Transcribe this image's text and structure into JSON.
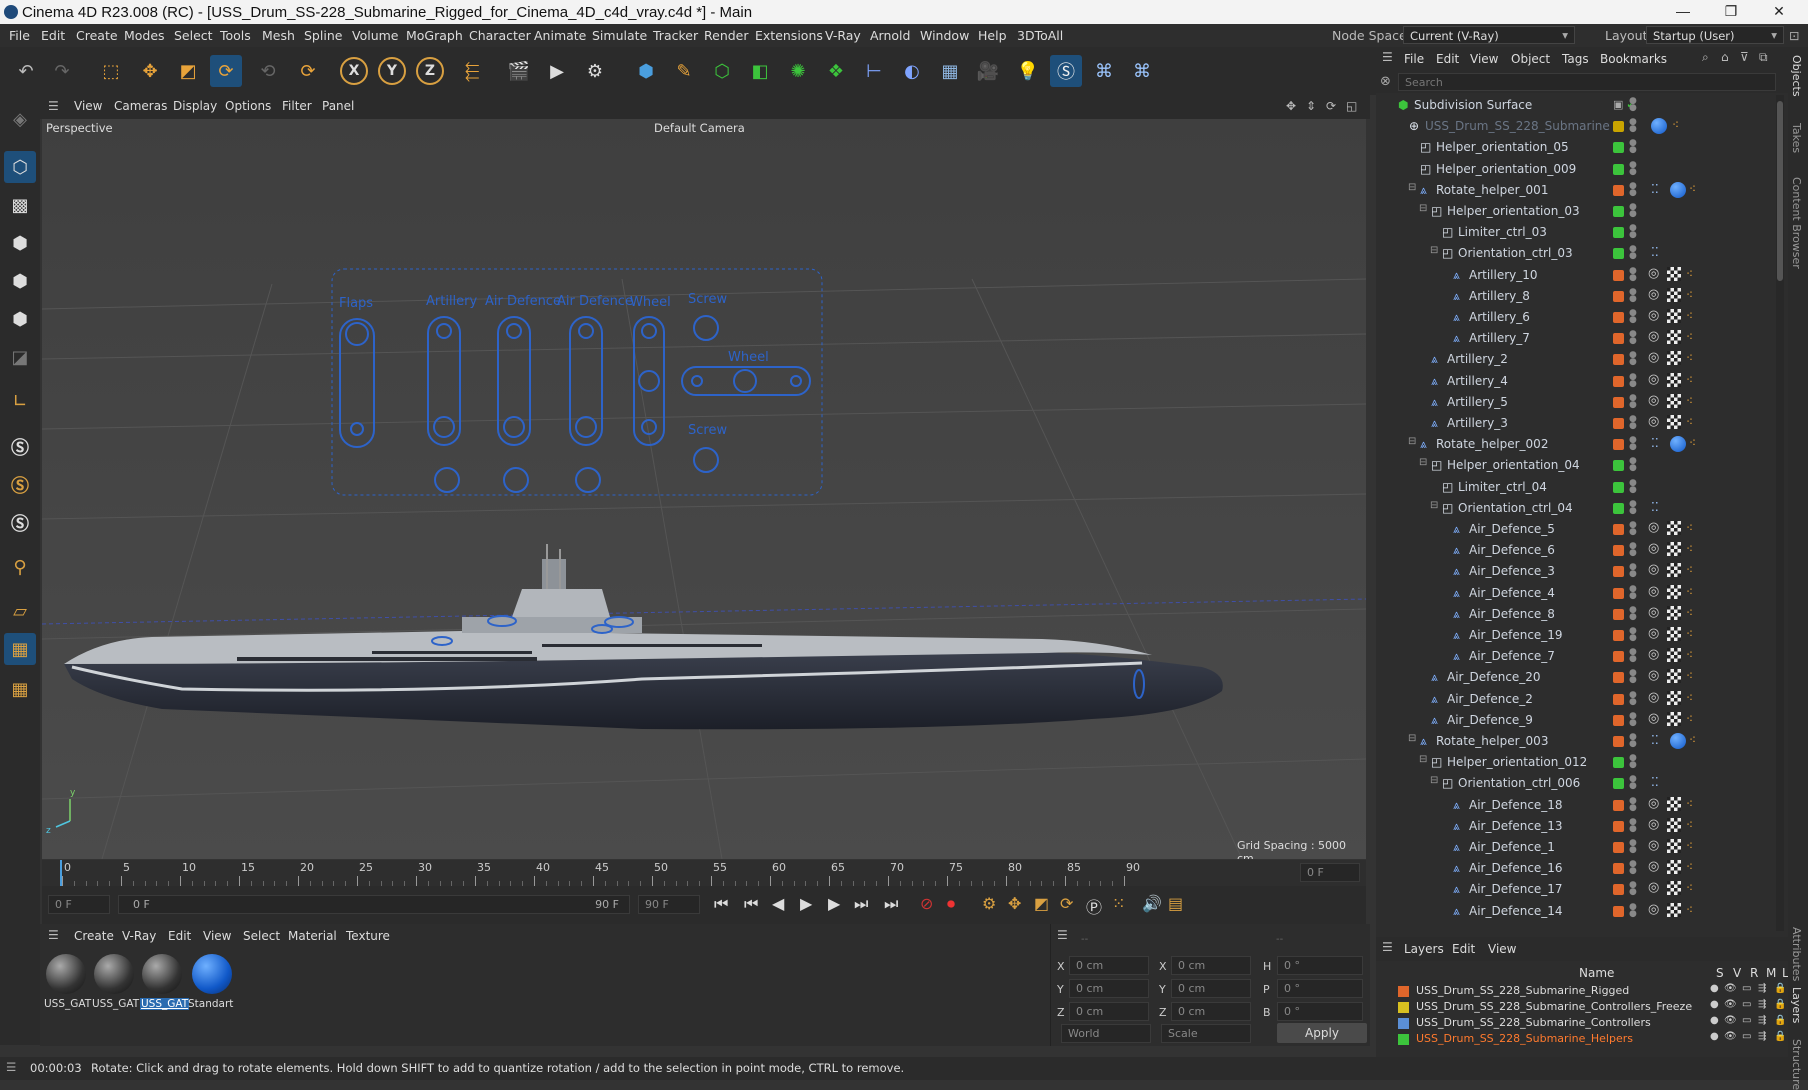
{
  "title_bar": {
    "text": "Cinema 4D R23.008 (RC) - [USS_Drum_SS-228_Submarine_Rigged_for_Cinema_4D_c4d_vray.c4d *] - Main",
    "minimize": "—",
    "maximize": "❐",
    "close": "✕"
  },
  "menu": [
    "File",
    "Edit",
    "Create",
    "Modes",
    "Select",
    "Tools",
    "Mesh",
    "Spline",
    "Volume",
    "MoGraph",
    "Character",
    "Animate",
    "Simulate",
    "Tracker",
    "Render",
    "Extensions",
    "V-Ray",
    "Arnold",
    "Window",
    "Help",
    "3DToAll"
  ],
  "node_space": {
    "label": "Node Space:",
    "value": "Current (V-Ray)"
  },
  "layout": {
    "label": "Layout:",
    "value": "Startup (User)"
  },
  "viewport": {
    "menu": [
      "View",
      "Cameras",
      "Display",
      "Options",
      "Filter",
      "Panel"
    ],
    "label": "Perspective",
    "camera": "Default Camera",
    "grid_spacing": "Grid Spacing : 5000 cm",
    "hud_labels": [
      "Flaps",
      "Artillery",
      "Air Defence",
      "Air Defence",
      "Wheel",
      "Screw",
      "Wheel",
      "Screw"
    ]
  },
  "timeline": {
    "ticks": [
      "0",
      "5",
      "10",
      "15",
      "20",
      "25",
      "30",
      "35",
      "40",
      "45",
      "50",
      "55",
      "60",
      "65",
      "70",
      "75",
      "80",
      "85",
      "90"
    ],
    "current_frame": "0 F",
    "start": "0 F",
    "range_start": "0 F",
    "range_end": "90 F",
    "end": "90 F"
  },
  "materials": {
    "menu": [
      "Create",
      "V-Ray",
      "Edit",
      "View",
      "Select",
      "Material",
      "Texture"
    ],
    "items": [
      "USS_GAT",
      "USS_GAT",
      "USS_GAT",
      "Standart"
    ]
  },
  "coords": {
    "rows": [
      {
        "a": "X",
        "av": "0 cm",
        "b": "X",
        "bv": "0 cm",
        "c": "H",
        "cv": "0 °"
      },
      {
        "a": "Y",
        "av": "0 cm",
        "b": "Y",
        "bv": "0 cm",
        "c": "P",
        "cv": "0 °"
      },
      {
        "a": "Z",
        "av": "0 cm",
        "b": "Z",
        "bv": "0 cm",
        "c": "B",
        "cv": "0 °"
      }
    ],
    "mode1": "World",
    "mode2": "Scale",
    "apply": "Apply",
    "dash1": "--",
    "dash2": "--"
  },
  "status": {
    "time": "00:00:03",
    "text": "Rotate: Click and drag to rotate elements. Hold down SHIFT to add to quantize rotation / add to the selection in point mode, CTRL to remove."
  },
  "objects": {
    "menu": [
      "File",
      "Edit",
      "View",
      "Object",
      "Tags",
      "Bookmarks"
    ],
    "search_placeholder": "Search",
    "rows": [
      {
        "name": "Subdivision Surface",
        "indent": 0,
        "color": "",
        "type": "subd"
      },
      {
        "name": "USS_Drum_SS_228_Submarine",
        "indent": 1,
        "color": "#c9a400",
        "type": "null",
        "dim": true
      },
      {
        "name": "Helper_orientation_05",
        "indent": 2,
        "color": "#3cc43c",
        "type": "helper"
      },
      {
        "name": "Helper_orientation_009",
        "indent": 2,
        "color": "#3cc43c",
        "type": "helper"
      },
      {
        "name": "Rotate_helper_001",
        "indent": 2,
        "color": "#e0662b",
        "type": "bone"
      },
      {
        "name": "Helper_orientation_03",
        "indent": 3,
        "color": "#3cc43c",
        "type": "helper"
      },
      {
        "name": "Limiter_ctrl_03",
        "indent": 4,
        "color": "#3cc43c",
        "type": "helper"
      },
      {
        "name": "Orientation_ctrl_03",
        "indent": 4,
        "color": "#3cc43c",
        "type": "helper"
      },
      {
        "name": "Artillery_10",
        "indent": 5,
        "color": "#e0662b",
        "type": "bone"
      },
      {
        "name": "Artillery_8",
        "indent": 5,
        "color": "#e0662b",
        "type": "bone"
      },
      {
        "name": "Artillery_6",
        "indent": 5,
        "color": "#e0662b",
        "type": "bone"
      },
      {
        "name": "Artillery_7",
        "indent": 5,
        "color": "#e0662b",
        "type": "bone"
      },
      {
        "name": "Artillery_2",
        "indent": 3,
        "color": "#e0662b",
        "type": "bone"
      },
      {
        "name": "Artillery_4",
        "indent": 3,
        "color": "#e0662b",
        "type": "bone"
      },
      {
        "name": "Artillery_5",
        "indent": 3,
        "color": "#e0662b",
        "type": "bone"
      },
      {
        "name": "Artillery_3",
        "indent": 3,
        "color": "#e0662b",
        "type": "bone"
      },
      {
        "name": "Rotate_helper_002",
        "indent": 2,
        "color": "#e0662b",
        "type": "bone"
      },
      {
        "name": "Helper_orientation_04",
        "indent": 3,
        "color": "#3cc43c",
        "type": "helper"
      },
      {
        "name": "Limiter_ctrl_04",
        "indent": 4,
        "color": "#3cc43c",
        "type": "helper"
      },
      {
        "name": "Orientation_ctrl_04",
        "indent": 4,
        "color": "#3cc43c",
        "type": "helper"
      },
      {
        "name": "Air_Defence_5",
        "indent": 5,
        "color": "#e0662b",
        "type": "bone"
      },
      {
        "name": "Air_Defence_6",
        "indent": 5,
        "color": "#e0662b",
        "type": "bone"
      },
      {
        "name": "Air_Defence_3",
        "indent": 5,
        "color": "#e0662b",
        "type": "bone"
      },
      {
        "name": "Air_Defence_4",
        "indent": 5,
        "color": "#e0662b",
        "type": "bone"
      },
      {
        "name": "Air_Defence_8",
        "indent": 5,
        "color": "#e0662b",
        "type": "bone"
      },
      {
        "name": "Air_Defence_19",
        "indent": 5,
        "color": "#e0662b",
        "type": "bone"
      },
      {
        "name": "Air_Defence_7",
        "indent": 5,
        "color": "#e0662b",
        "type": "bone"
      },
      {
        "name": "Air_Defence_20",
        "indent": 3,
        "color": "#e0662b",
        "type": "bone"
      },
      {
        "name": "Air_Defence_2",
        "indent": 3,
        "color": "#e0662b",
        "type": "bone"
      },
      {
        "name": "Air_Defence_9",
        "indent": 3,
        "color": "#e0662b",
        "type": "bone"
      },
      {
        "name": "Rotate_helper_003",
        "indent": 2,
        "color": "#e0662b",
        "type": "bone"
      },
      {
        "name": "Helper_orientation_012",
        "indent": 3,
        "color": "#3cc43c",
        "type": "helper"
      },
      {
        "name": "Orientation_ctrl_006",
        "indent": 4,
        "color": "#3cc43c",
        "type": "helper"
      },
      {
        "name": "Air_Defence_18",
        "indent": 5,
        "color": "#e0662b",
        "type": "bone"
      },
      {
        "name": "Air_Defence_13",
        "indent": 5,
        "color": "#e0662b",
        "type": "bone"
      },
      {
        "name": "Air_Defence_1",
        "indent": 5,
        "color": "#e0662b",
        "type": "bone"
      },
      {
        "name": "Air_Defence_16",
        "indent": 5,
        "color": "#e0662b",
        "type": "bone"
      },
      {
        "name": "Air_Defence_17",
        "indent": 5,
        "color": "#e0662b",
        "type": "bone"
      },
      {
        "name": "Air_Defence_14",
        "indent": 5,
        "color": "#e0662b",
        "type": "bone"
      }
    ]
  },
  "layers": {
    "menu": [
      "Layers",
      "Edit",
      "View"
    ],
    "header": {
      "name": "Name",
      "cols": [
        "S",
        "V",
        "R",
        "M",
        "L"
      ]
    },
    "rows": [
      {
        "name": "USS_Drum_SS_228_Submarine_Rigged",
        "color": "#e0662b",
        "active": false
      },
      {
        "name": "USS_Drum_SS_228_Submarine_Controllers_Freeze",
        "color": "#d8c020",
        "active": false
      },
      {
        "name": "USS_Drum_SS_228_Submarine_Controllers",
        "color": "#5b8fd6",
        "active": false
      },
      {
        "name": "USS_Drum_SS_228_Submarine_Helpers",
        "color": "#3cc43c",
        "active": true
      }
    ]
  },
  "side_tabs": [
    "Objects",
    "Takes",
    "Content Browser",
    "Attributes",
    "Layers",
    "Structure"
  ]
}
